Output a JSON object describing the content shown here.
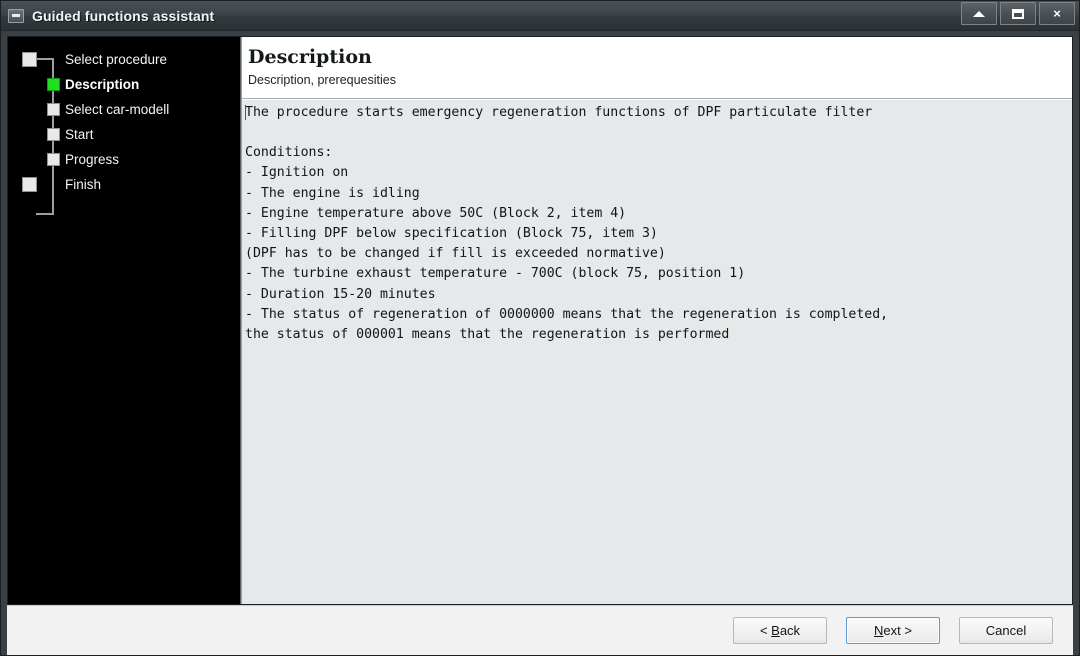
{
  "window": {
    "title": "Guided functions assistant",
    "sys_icon": "minimize-box-icon",
    "controls": [
      {
        "name": "minimize-button",
        "glyph": "up-arrow-icon"
      },
      {
        "name": "restore-button",
        "glyph": "restore-box-icon"
      },
      {
        "name": "close-button",
        "glyph": "×"
      }
    ]
  },
  "sidebar": {
    "steps": [
      {
        "label": "Select procedure",
        "state": "pending",
        "kind": "end"
      },
      {
        "label": "Description",
        "state": "active",
        "kind": "mid"
      },
      {
        "label": "Select car-modell",
        "state": "pending",
        "kind": "mid"
      },
      {
        "label": "Start",
        "state": "pending",
        "kind": "mid"
      },
      {
        "label": "Progress",
        "state": "pending",
        "kind": "mid"
      },
      {
        "label": "Finish",
        "state": "pending",
        "kind": "end"
      }
    ],
    "active_color": "#1fe01f",
    "node_color": "#e9e9e9",
    "background": "#000000"
  },
  "page": {
    "title": "Description",
    "subtitle": "Description, prerequesities",
    "body": "The procedure starts emergency regeneration functions of DPF particulate filter\n\nConditions:\n- Ignition on\n- The engine is idling\n- Engine temperature above 50C (Block 2, item 4)\n- Filling DPF below specification (Block 75, item 3)\n(DPF has to be changed if fill is exceeded normative)\n- The turbine exhaust temperature - 700C (block 75, position 1)\n- Duration 15-20 minutes\n- The status of regeneration of 0000000 means that the regeneration is completed,\nthe status of 000001 means that the regeneration is performed"
  },
  "footer": {
    "back_label": "< Back",
    "back_mnemonic": "B",
    "next_label": "Next >",
    "next_mnemonic": "N",
    "cancel_label": "Cancel",
    "focused_button": "Next >"
  }
}
